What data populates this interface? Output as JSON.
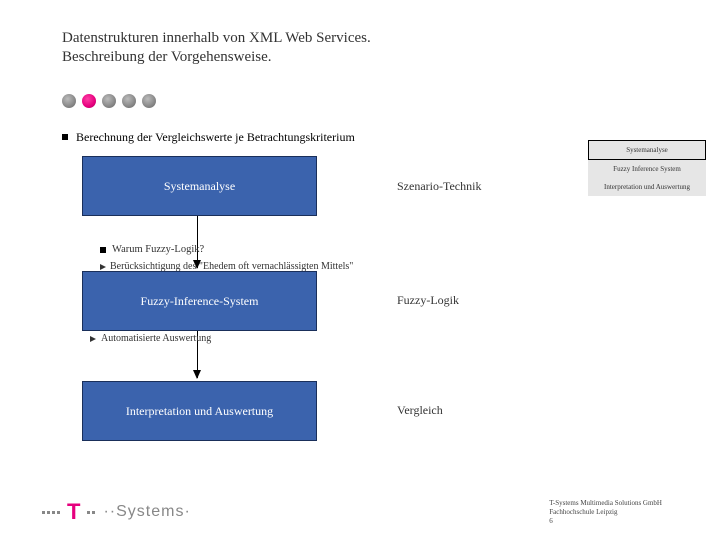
{
  "header": {
    "title": "Datenstrukturen innerhalb von XML Web Services.",
    "subtitle": "Beschreibung der Vorgehensweise."
  },
  "progress": {
    "dots": 5,
    "active_index": 1,
    "accent_color": "#e6007e"
  },
  "bullets": {
    "b1": "Berechnung der Vergleichswerte je Betrachtungskriterium",
    "b2": "Warum Fuzzy-Logik?",
    "b2_sub": "Berücksichtigung des \"Ehedem oft vernachlässigten Mittels\"",
    "b2_auto": "Automatisierte Auswertung"
  },
  "diagram": {
    "box1": "Systemanalyse",
    "box2": "Fuzzy-Inference-System",
    "box3": "Interpretation und Auswertung",
    "label1": "Szenario-Technik",
    "label2": "Fuzzy-Logik",
    "label3": "Vergleich"
  },
  "sidebar": {
    "s1": "Systemanalyse",
    "s2": "Fuzzy Inference System",
    "s3": "Interpretation und Auswertung"
  },
  "footer": {
    "brand_letter": "T",
    "brand_text": "··Systems·",
    "line1": "T-Systems Multimedia Solutions GmbH",
    "line2": "Fachhochschule Leipzig",
    "line3": "6"
  }
}
